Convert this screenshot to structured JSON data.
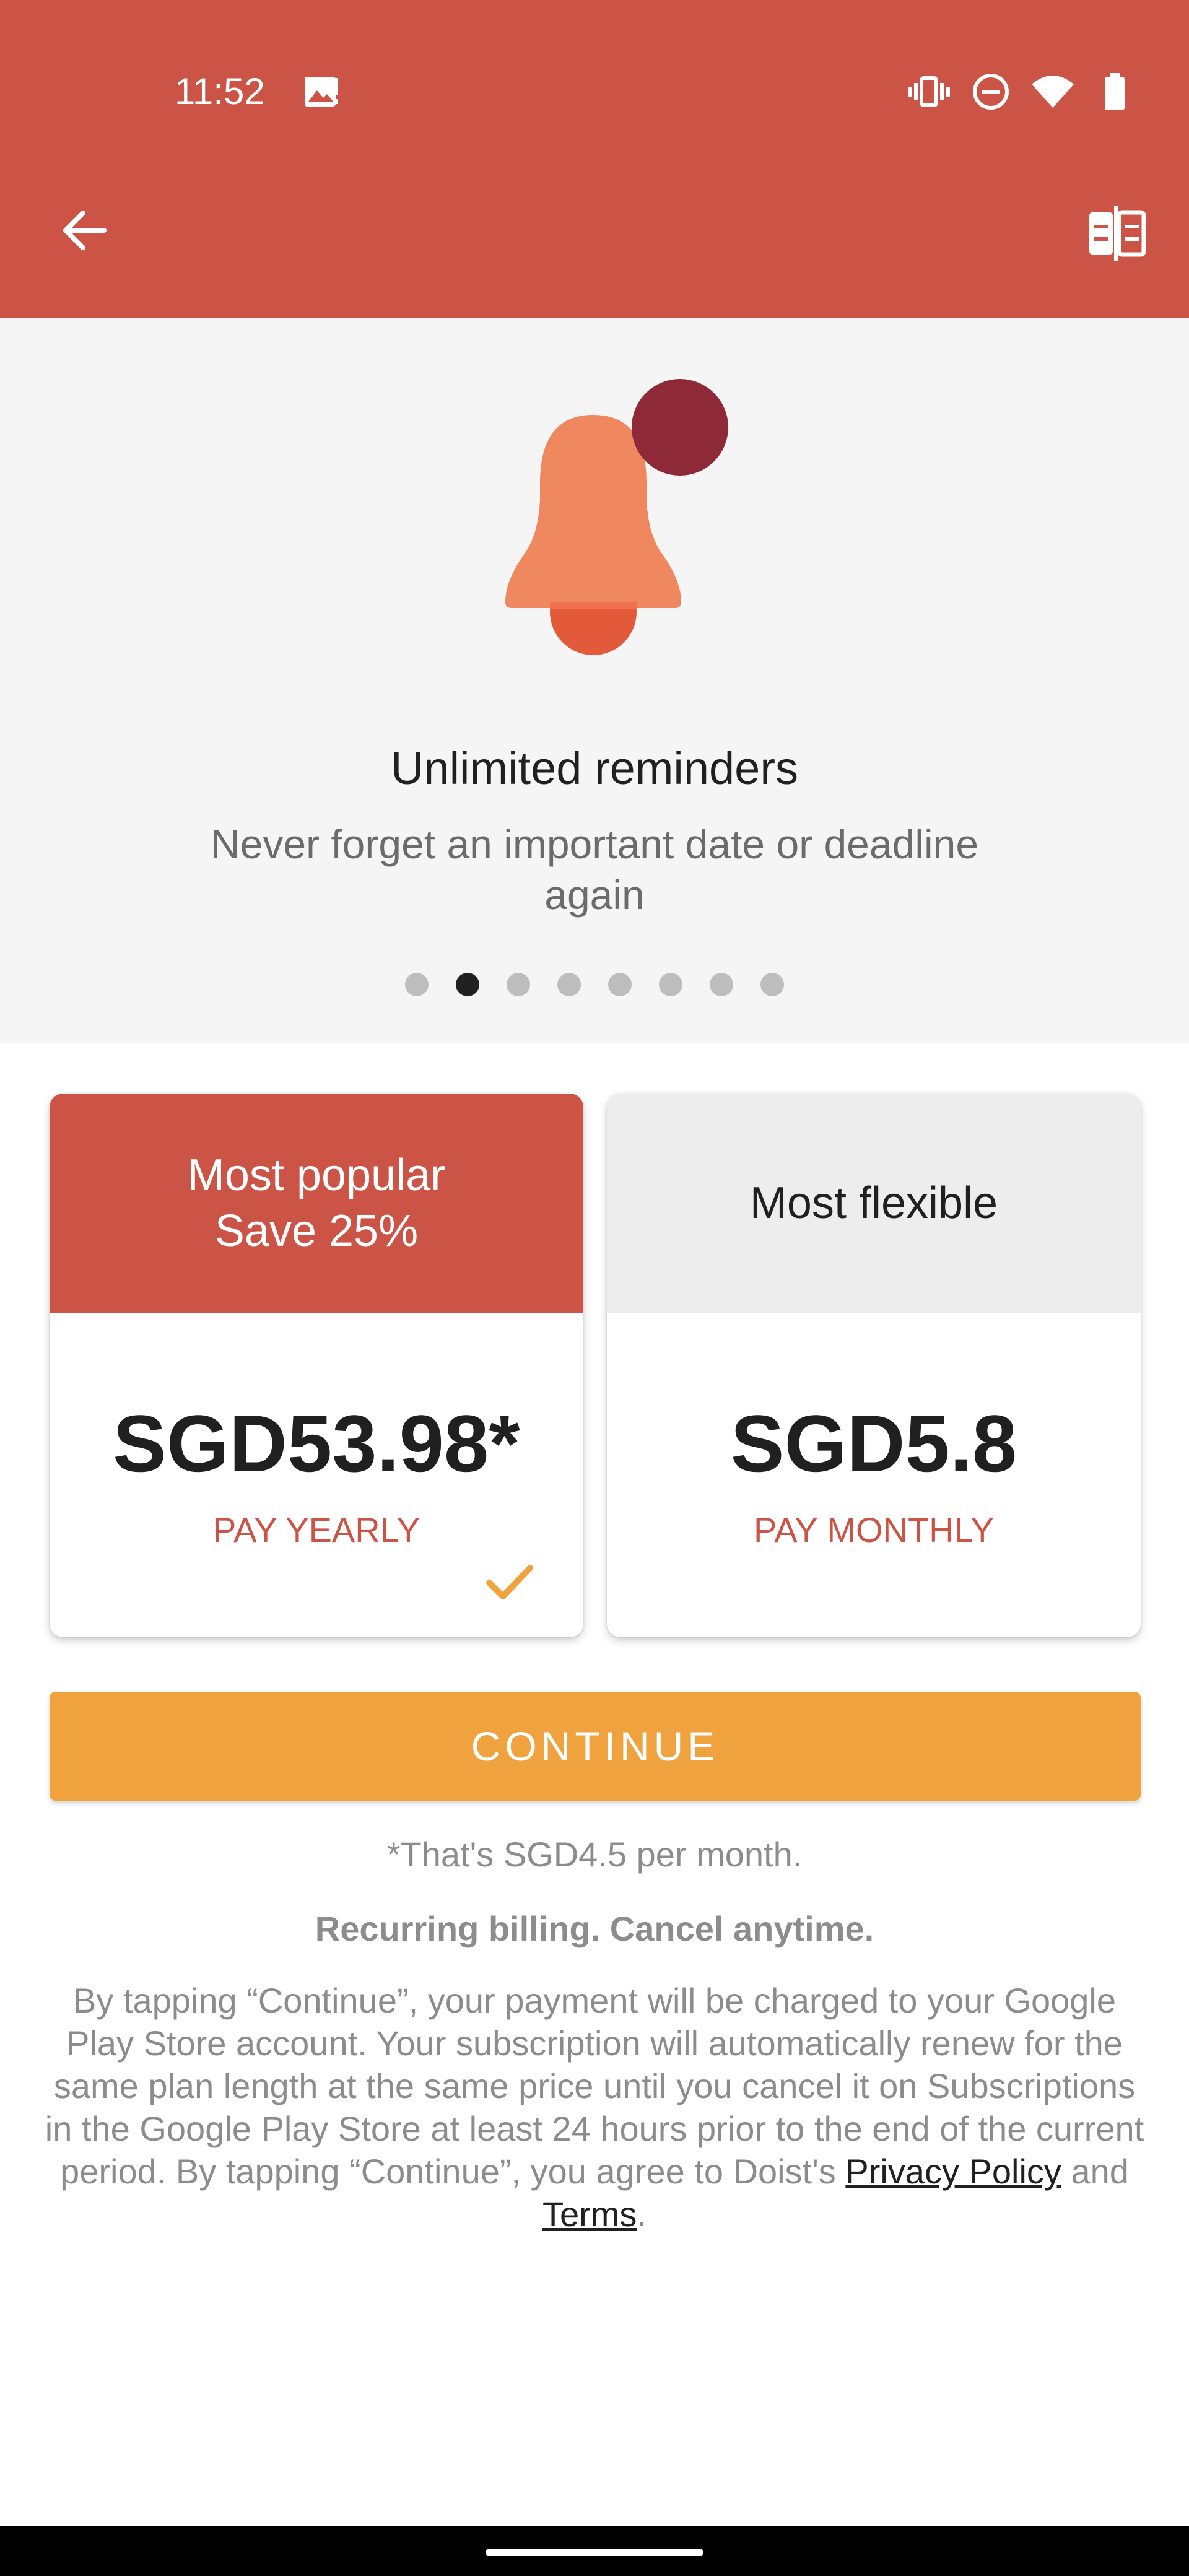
{
  "status_bar": {
    "time": "11:52",
    "icons": [
      "image-notification-icon",
      "vibrate-icon",
      "do-not-disturb-icon",
      "wifi-icon",
      "battery-icon"
    ]
  },
  "toolbar": {
    "back_icon": "arrow-left-icon",
    "compare_icon": "compare-plans-icon"
  },
  "feature": {
    "icon": "bell-icon",
    "title": "Unlimited reminders",
    "description": "Never forget an important date or deadline again",
    "pagination": {
      "total": 8,
      "active_index": 1
    }
  },
  "plans": [
    {
      "header_line1": "Most popular",
      "header_line2": "Save 25%",
      "price": "SGD53.98*",
      "period": "PAY YEARLY",
      "selected": true
    },
    {
      "header_line1": "Most flexible",
      "price": "SGD5.8",
      "period": "PAY MONTHLY",
      "selected": false
    }
  ],
  "continue_label": "CONTINUE",
  "notes": {
    "monthly_equivalent": "*That's SGD4.5 per month.",
    "recurring": "Recurring billing. Cancel anytime.",
    "legal_text": "By tapping “Continue”, your payment will be charged to your Google Play Store account. Your subscription will automatically renew for the same plan length at the same price until you cancel it on Subscriptions in the Google Play Store at least 24 hours prior to the end of the current period. By tapping “Continue”, you agree to Doist's",
    "privacy_link": "Privacy Policy",
    "and_text": "and",
    "terms_link": "Terms",
    "end_period": "."
  },
  "colors": {
    "brand_red": "#CB5447",
    "accent_orange": "#F0A23E",
    "bell_orange": "#EF885F",
    "bell_dot": "#8E2937"
  }
}
